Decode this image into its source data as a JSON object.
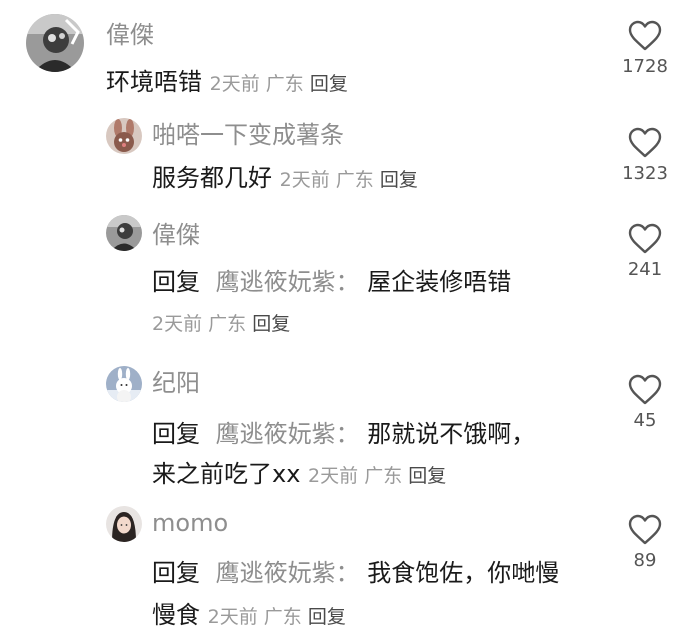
{
  "comments": [
    {
      "username": "偉傑",
      "text": "环境唔错",
      "time": "2天前",
      "location": "广东",
      "reply_label": "回复",
      "like_count": "1728",
      "avatar_icon": "portrait-photo-icon"
    },
    {
      "username": "啪嗒一下变成薯条",
      "text": "服务都几好",
      "time": "2天前",
      "location": "广东",
      "reply_label": "回复",
      "like_count": "1323",
      "avatar_icon": "bunny-avatar-icon"
    },
    {
      "username": "偉傑",
      "reply_prefix": "回复",
      "reply_target": "鹰逃筱妧紫：",
      "text": "屋企装修唔错",
      "time": "2天前",
      "location": "广东",
      "reply_label": "回复",
      "like_count": "241",
      "avatar_icon": "portrait-photo-icon"
    },
    {
      "username": "纪阳",
      "reply_prefix": "回复",
      "reply_target": "鹰逃筱妧紫：",
      "text": "那就说不饿啊，来之前吃了xx",
      "time": "2天前",
      "location": "广东",
      "reply_label": "回复",
      "like_count": "45",
      "avatar_icon": "snowman-avatar-icon"
    },
    {
      "username": "momo",
      "reply_prefix": "回复",
      "reply_target": "鹰逃筱妧紫：",
      "text": "我食饱佐，你哋慢慢食",
      "time": "2天前",
      "location": "广东",
      "reply_label": "回复",
      "like_count": "89",
      "avatar_icon": "girl-avatar-icon"
    }
  ],
  "like_icon": "heart-outline-icon"
}
